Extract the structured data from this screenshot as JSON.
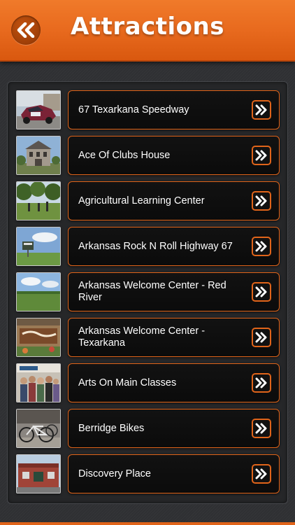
{
  "header": {
    "title": "Attractions",
    "back_icon": "double-chevron-left-icon",
    "color": "#e86a1e"
  },
  "items": [
    {
      "label": "67 Texarkana Speedway",
      "thumb": "race-car-photo"
    },
    {
      "label": "Ace Of Clubs House",
      "thumb": "historic-house-photo"
    },
    {
      "label": "Agricultural Learning Center",
      "thumb": "trees-field-photo"
    },
    {
      "label": "Arkansas Rock N Roll Highway 67",
      "thumb": "highway-sign-photo"
    },
    {
      "label": "Arkansas Welcome Center - Red River",
      "thumb": "field-sky-photo"
    },
    {
      "label": "Arkansas Welcome Center - Texarkana",
      "thumb": "welcome-sign-photo"
    },
    {
      "label": "Arts On Main Classes",
      "thumb": "group-people-photo"
    },
    {
      "label": "Berridge Bikes",
      "thumb": "bicycles-photo"
    },
    {
      "label": "Discovery Place",
      "thumb": "building-photo"
    }
  ],
  "accent_color": "#e0641a",
  "row_icon": "double-chevron-right-icon"
}
